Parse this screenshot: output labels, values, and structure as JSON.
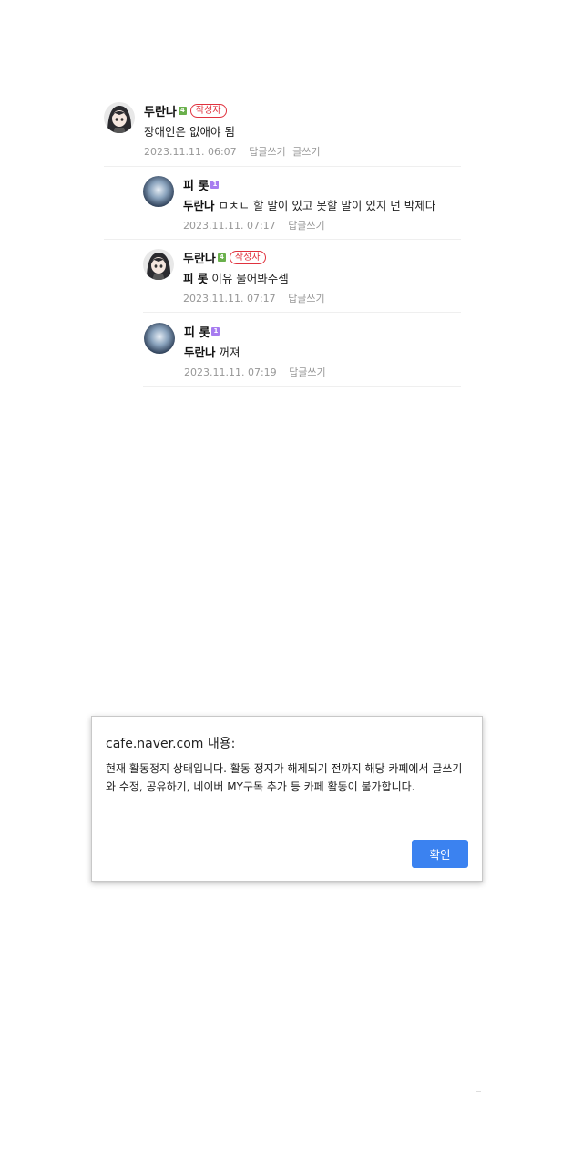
{
  "colors": {
    "level_green": "#6ab04c",
    "level_purple": "#a77cf0",
    "writer_badge": "#e0323e",
    "meta_text": "#979797",
    "dialog_button": "#3b82f0"
  },
  "comments": [
    {
      "author": "두란나",
      "level": "4",
      "level_color": "green",
      "writer_badge": "작성자",
      "mention": "",
      "text": "장애인은 없애야 됨",
      "date": "2023.11.11. 06:07",
      "reply_label": "답글쓰기",
      "extra_label": "글쓰기",
      "avatar": "anime-girl"
    },
    {
      "author": "피 롯",
      "level": "1",
      "level_color": "purple",
      "writer_badge": "",
      "mention": "두란나",
      "text": " ㅁㅊㄴ 할 말이 있고 못할 말이 있지 넌 박제다",
      "date": "2023.11.11. 07:17",
      "reply_label": "답글쓰기",
      "avatar": "blue-glow"
    },
    {
      "author": "두란나",
      "level": "4",
      "level_color": "green",
      "writer_badge": "작성자",
      "mention": "피 롯",
      "text": " 이유 물어봐주셈",
      "date": "2023.11.11. 07:17",
      "reply_label": "답글쓰기",
      "avatar": "anime-girl"
    },
    {
      "author": "피 롯",
      "level": "1",
      "level_color": "purple",
      "writer_badge": "",
      "mention": "두란나",
      "text": " 꺼져",
      "date": "2023.11.11. 07:19",
      "reply_label": "답글쓰기",
      "avatar": "blue-glow"
    }
  ],
  "dialog": {
    "title": "cafe.naver.com 내용:",
    "message": "현재 활동정지 상태입니다.  활동 정지가 해제되기 전까지 해당 카페에서 글쓰기와 수정, 공유하기, 네이버 MY구독 추가 등 카페 활동이 불가합니다.",
    "ok_label": "확인"
  }
}
